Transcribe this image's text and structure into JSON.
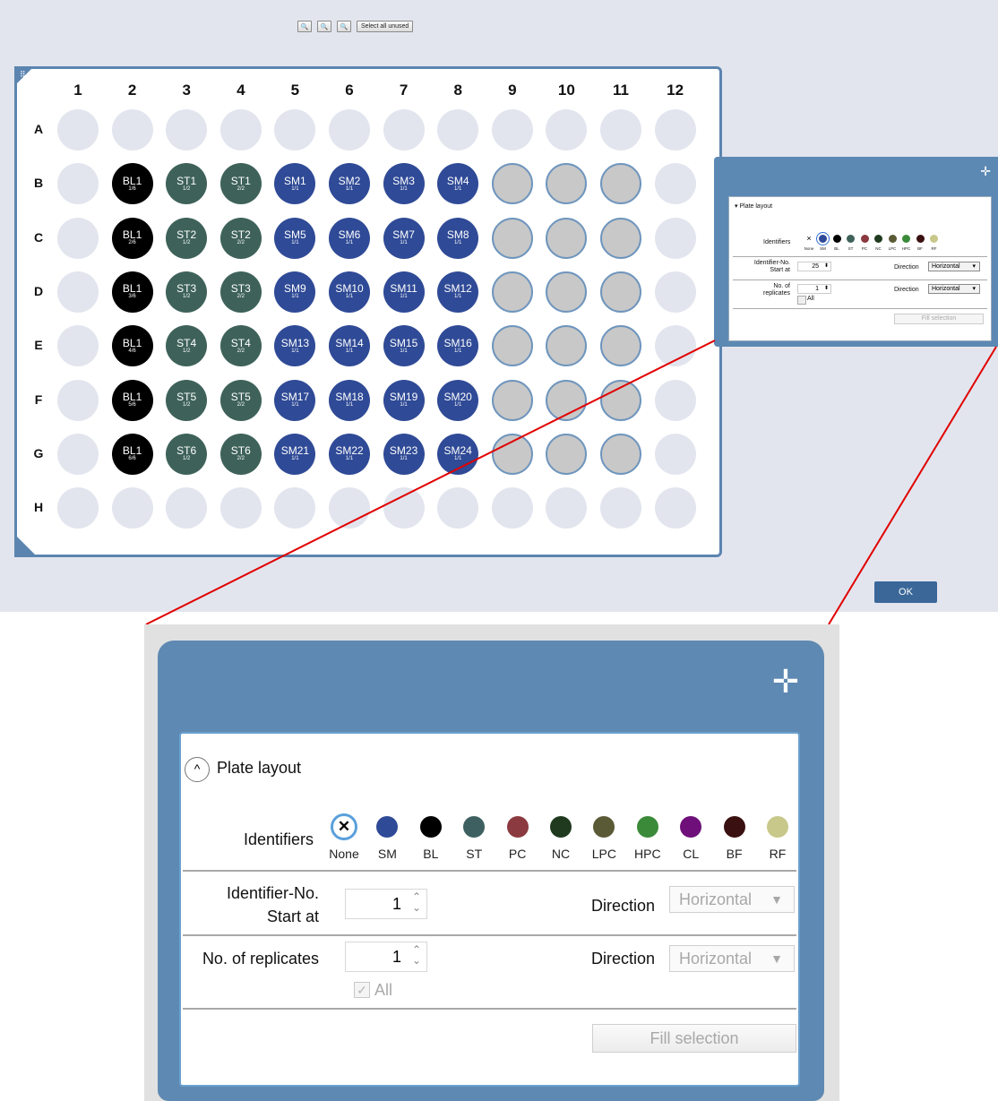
{
  "toolbar": {
    "zoom_in_icon": "zoom-in-icon",
    "zoom_out_icon": "zoom-out-icon",
    "zoom_fit_icon": "zoom-fit-icon",
    "select_all_unused_label": "Select all unused"
  },
  "plate": {
    "columns": [
      "1",
      "2",
      "3",
      "4",
      "5",
      "6",
      "7",
      "8",
      "9",
      "10",
      "11",
      "12"
    ],
    "rows": [
      "A",
      "B",
      "C",
      "D",
      "E",
      "F",
      "G",
      "H"
    ],
    "identifier_colors": {
      "SM": "#2f4a96",
      "BL": "#000000",
      "ST": "#3e6259"
    },
    "wells": {
      "A": [
        null,
        null,
        null,
        null,
        null,
        null,
        null,
        null,
        null,
        null,
        null,
        null
      ],
      "B": [
        null,
        {
          "id": "BL1",
          "sub": "1/6",
          "type": "BL"
        },
        {
          "id": "ST1",
          "sub": "1/2",
          "type": "ST"
        },
        {
          "id": "ST1",
          "sub": "2/2",
          "type": "ST"
        },
        {
          "id": "SM1",
          "sub": "1/1",
          "type": "SM"
        },
        {
          "id": "SM2",
          "sub": "1/1",
          "type": "SM"
        },
        {
          "id": "SM3",
          "sub": "1/1",
          "type": "SM"
        },
        {
          "id": "SM4",
          "sub": "1/1",
          "type": "SM"
        },
        "unused",
        "unused",
        "unused",
        null
      ],
      "C": [
        null,
        {
          "id": "BL1",
          "sub": "2/6",
          "type": "BL"
        },
        {
          "id": "ST2",
          "sub": "1/2",
          "type": "ST"
        },
        {
          "id": "ST2",
          "sub": "2/2",
          "type": "ST"
        },
        {
          "id": "SM5",
          "sub": "1/1",
          "type": "SM"
        },
        {
          "id": "SM6",
          "sub": "1/1",
          "type": "SM"
        },
        {
          "id": "SM7",
          "sub": "1/1",
          "type": "SM"
        },
        {
          "id": "SM8",
          "sub": "1/1",
          "type": "SM"
        },
        "unused",
        "unused",
        "unused",
        null
      ],
      "D": [
        null,
        {
          "id": "BL1",
          "sub": "3/6",
          "type": "BL"
        },
        {
          "id": "ST3",
          "sub": "1/2",
          "type": "ST"
        },
        {
          "id": "ST3",
          "sub": "2/2",
          "type": "ST"
        },
        {
          "id": "SM9",
          "sub": "1/1",
          "type": "SM"
        },
        {
          "id": "SM10",
          "sub": "1/1",
          "type": "SM"
        },
        {
          "id": "SM11",
          "sub": "1/1",
          "type": "SM"
        },
        {
          "id": "SM12",
          "sub": "1/1",
          "type": "SM"
        },
        "unused",
        "unused",
        "unused",
        null
      ],
      "E": [
        null,
        {
          "id": "BL1",
          "sub": "4/6",
          "type": "BL"
        },
        {
          "id": "ST4",
          "sub": "1/2",
          "type": "ST"
        },
        {
          "id": "ST4",
          "sub": "2/2",
          "type": "ST"
        },
        {
          "id": "SM13",
          "sub": "1/1",
          "type": "SM"
        },
        {
          "id": "SM14",
          "sub": "1/1",
          "type": "SM"
        },
        {
          "id": "SM15",
          "sub": "1/1",
          "type": "SM"
        },
        {
          "id": "SM16",
          "sub": "1/1",
          "type": "SM"
        },
        "unused",
        "unused",
        "unused",
        null
      ],
      "F": [
        null,
        {
          "id": "BL1",
          "sub": "5/6",
          "type": "BL"
        },
        {
          "id": "ST5",
          "sub": "1/2",
          "type": "ST"
        },
        {
          "id": "ST5",
          "sub": "2/2",
          "type": "ST"
        },
        {
          "id": "SM17",
          "sub": "1/1",
          "type": "SM"
        },
        {
          "id": "SM18",
          "sub": "1/1",
          "type": "SM"
        },
        {
          "id": "SM19",
          "sub": "1/1",
          "type": "SM"
        },
        {
          "id": "SM20",
          "sub": "1/1",
          "type": "SM"
        },
        "unused",
        "unused",
        "unused",
        null
      ],
      "G": [
        null,
        {
          "id": "BL1",
          "sub": "6/6",
          "type": "BL"
        },
        {
          "id": "ST6",
          "sub": "1/2",
          "type": "ST"
        },
        {
          "id": "ST6",
          "sub": "2/2",
          "type": "ST"
        },
        {
          "id": "SM21",
          "sub": "1/1",
          "type": "SM"
        },
        {
          "id": "SM22",
          "sub": "1/1",
          "type": "SM"
        },
        {
          "id": "SM23",
          "sub": "1/1",
          "type": "SM"
        },
        {
          "id": "SM24",
          "sub": "1/1",
          "type": "SM"
        },
        "unused",
        "unused",
        "unused",
        null
      ],
      "H": [
        null,
        null,
        null,
        null,
        null,
        null,
        null,
        null,
        null,
        null,
        null,
        null
      ]
    }
  },
  "small_dialog": {
    "section_label": "Plate layout",
    "identifiers_label": "Identifiers",
    "identifiers": [
      {
        "code": "None",
        "color": "none"
      },
      {
        "code": "SM",
        "color": "#2f4a96"
      },
      {
        "code": "BL",
        "color": "#000000"
      },
      {
        "code": "ST",
        "color": "#3e6259"
      },
      {
        "code": "PC",
        "color": "#8b3a3f"
      },
      {
        "code": "NC",
        "color": "#1f3a1f"
      },
      {
        "code": "LPC",
        "color": "#5a5a36"
      },
      {
        "code": "HPC",
        "color": "#3a8a3a"
      },
      {
        "code": "BF",
        "color": "#3a1010"
      },
      {
        "code": "RF",
        "color": "#c8c88a"
      }
    ],
    "identifier_no_label_1": "Identifier-No.",
    "identifier_no_label_2": "Start at",
    "identifier_no_value": "25",
    "direction_label": "Direction",
    "direction_1": "Horizontal",
    "replicates_label_1": "No. of",
    "replicates_label_2": "replicates",
    "replicates_value": "1",
    "direction_2": "Horizontal",
    "all_label": "All",
    "fill_label": "Fill selection"
  },
  "ok_label": "OK",
  "zoom_dialog": {
    "section_label": "Plate layout",
    "identifiers_label": "Identifiers",
    "identifiers": [
      {
        "code": "None",
        "color": "none"
      },
      {
        "code": "SM",
        "color": "#2f4a96"
      },
      {
        "code": "BL",
        "color": "#000000"
      },
      {
        "code": "ST",
        "color": "#3f6060"
      },
      {
        "code": "PC",
        "color": "#8b3a3f"
      },
      {
        "code": "NC",
        "color": "#1f3a1f"
      },
      {
        "code": "LPC",
        "color": "#5a5a36"
      },
      {
        "code": "HPC",
        "color": "#3a8a3a"
      },
      {
        "code": "CL",
        "color": "#6e0f7a"
      },
      {
        "code": "BF",
        "color": "#3a1010"
      },
      {
        "code": "RF",
        "color": "#c8c88a"
      }
    ],
    "identifier_no_label_1": "Identifier-No.",
    "identifier_no_label_2": "Start at",
    "identifier_no_value": "1",
    "direction_label": "Direction",
    "direction_1": "Horizontal",
    "replicates_label": "No. of replicates",
    "replicates_value": "1",
    "direction_2": "Horizontal",
    "all_label": "All",
    "fill_label": "Fill selection"
  }
}
